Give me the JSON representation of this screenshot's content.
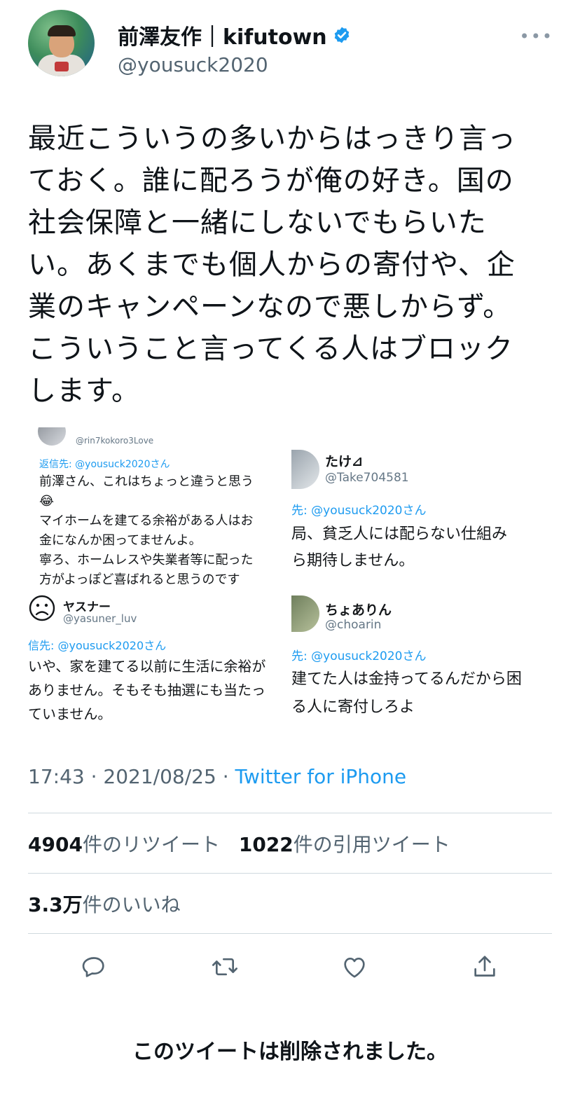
{
  "author": {
    "display_name": "前澤友作｜kifutown",
    "handle": "@yousuck2020"
  },
  "tweet": {
    "lines": [
      "最近こういうの多いからはっきり言っ",
      "ておく。誰に配ろうが俺の好き。国の",
      "社会保障と一緒にしないでもらいた",
      "い。あくまでも個人からの寄付や、企",
      "業のキャンペーンなので悪しからず。",
      "こういうこと言ってくる人はブロック",
      "します。"
    ]
  },
  "media": {
    "reply1": {
      "handle": "@rin7kokoro3Love",
      "reply_to": "返信先: @yousuck2020さん",
      "lines": [
        "前澤さん、これはちょっと違うと思う",
        "😂",
        "マイホームを建てる余裕がある人はお",
        "金になんか困ってませんよ。",
        "寧ろ、ホームレスや失業者等に配った",
        "方がよっぽど喜ばれると思うのです"
      ]
    },
    "reply2": {
      "name": "たけ⊿",
      "handle": "@Take704581",
      "reply_to": "先: @yousuck2020さん",
      "lines": [
        "局、貧乏人には配らない仕組み",
        "ら期待しません。"
      ]
    },
    "reply3": {
      "name": "ヤスナー",
      "handle": "@yasuner_luv",
      "reply_to": "信先: @yousuck2020さん",
      "lines": [
        "いや、家を建てる以前に生活に余裕が",
        "ありません。そもそも抽選にも当たっ",
        "ていません。"
      ]
    },
    "reply4": {
      "name": "ちょありん",
      "handle": "@choarin",
      "reply_to": "先: @yousuck2020さん",
      "lines": [
        "建てた人は金持ってるんだから困",
        "る人に寄付しろよ"
      ]
    }
  },
  "meta": {
    "time": "17:43",
    "sep": " · ",
    "date": "2021/08/25",
    "source": "Twitter for iPhone"
  },
  "stats": {
    "retweets_count": "4904",
    "retweets_label": "件のリツイート",
    "quotes_count": "1022",
    "quotes_label": "件の引用ツイート",
    "likes_count": "3.3万",
    "likes_label": "件のいいね"
  },
  "actions": {
    "reply_icon": "reply-icon",
    "retweet_icon": "retweet-icon",
    "like_icon": "like-icon",
    "share_icon": "share-icon"
  },
  "status": {
    "deleted_message": "このツイートは削除されました。"
  },
  "colors": {
    "accent": "#1d9bf0",
    "text": "#0f1419",
    "secondary": "#536471",
    "divider": "#cfd9de"
  }
}
